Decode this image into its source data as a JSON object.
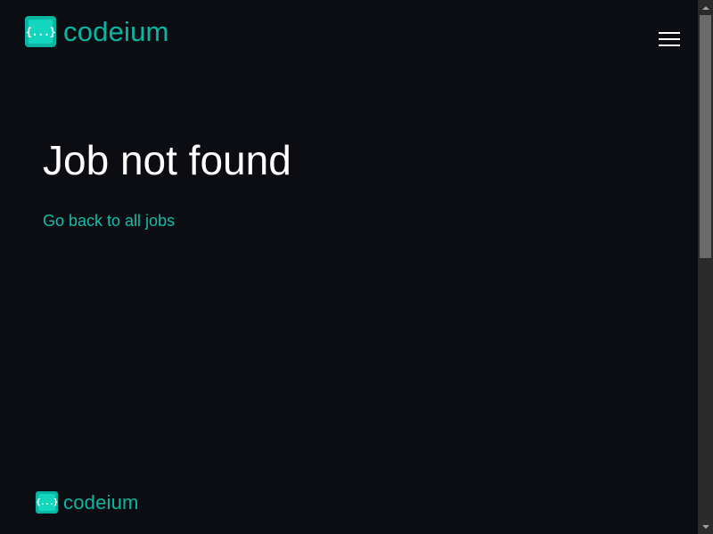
{
  "header": {
    "logo_glyph": "{...}",
    "logo_text": "codeium",
    "menu_icon": "hamburger-menu-icon"
  },
  "main": {
    "title": "Job not found",
    "back_link": "Go back to all jobs"
  },
  "footer": {
    "logo_glyph": "{...}",
    "logo_text": "codeium"
  },
  "colors": {
    "background": "#0b0d13",
    "brand_teal": "#09b6a2",
    "brand_teal_light": "#12d6bd",
    "link": "#12bfa8",
    "title": "#ffffff",
    "scrollbar_track": "#2b2b2b",
    "scrollbar_thumb": "#6b6b6b"
  }
}
